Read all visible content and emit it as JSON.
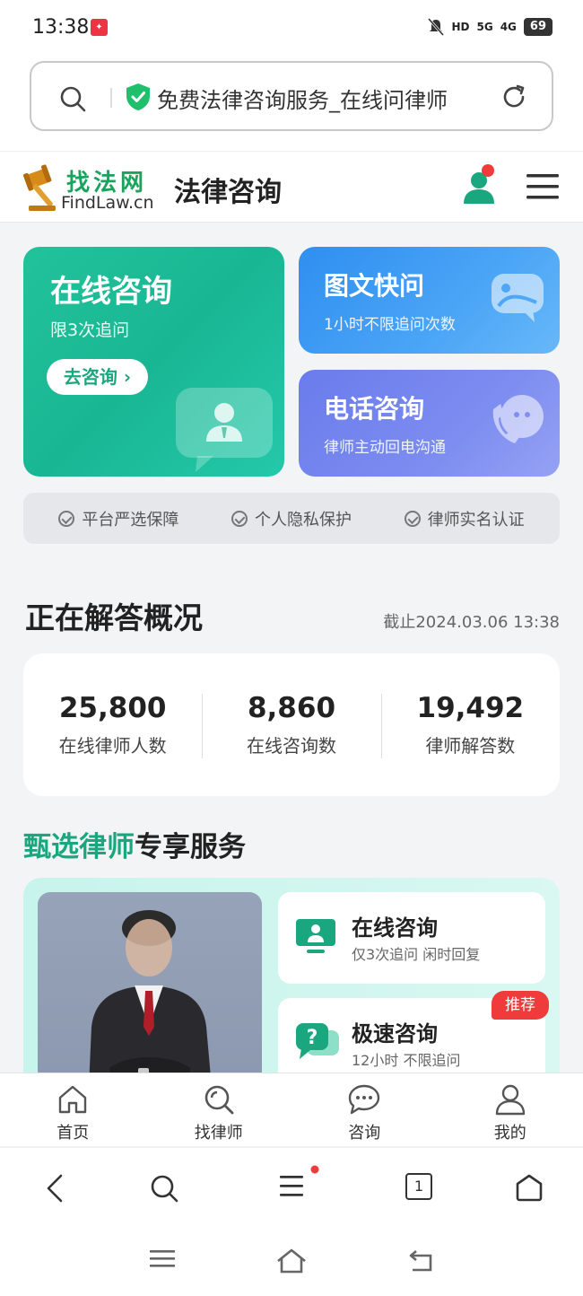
{
  "status": {
    "time": "13:38",
    "battery": "69",
    "network": [
      "HD",
      "5G",
      "4G"
    ]
  },
  "browser": {
    "url_title": "免费法律咨询服务_在线问律师"
  },
  "header": {
    "logo_cn": "找法网",
    "logo_en": "FindLaw.cn",
    "title": "法律咨询"
  },
  "hero": {
    "online": {
      "title": "在线咨询",
      "sub": "限3次追问",
      "button": "去咨询 ›"
    },
    "picture": {
      "title": "图文快问",
      "sub": "1小时不限追问次数"
    },
    "phone": {
      "title": "电话咨询",
      "sub": "律师主动回电沟通"
    }
  },
  "guarantees": [
    "平台严选保障",
    "个人隐私保护",
    "律师实名认证"
  ],
  "stats_section": {
    "title": "正在解答概况",
    "date": "截止2024.03.06 13:38",
    "items": [
      {
        "value": "25,800",
        "label": "在线律师人数"
      },
      {
        "value": "8,860",
        "label": "在线咨询数"
      },
      {
        "value": "19,492",
        "label": "律师解答数"
      }
    ]
  },
  "lawyer_section": {
    "title_highlight": "甄选律师",
    "title_rest": "专享服务",
    "services": [
      {
        "title": "在线咨询",
        "sub": "仅3次追问 闲时回复"
      },
      {
        "title": "极速咨询",
        "sub": "12小时 不限追问",
        "badge": "推荐"
      }
    ]
  },
  "tabs": [
    {
      "label": "首页",
      "icon": "home-icon"
    },
    {
      "label": "找律师",
      "icon": "search-icon"
    },
    {
      "label": "咨询",
      "icon": "chat-icon"
    },
    {
      "label": "我的",
      "icon": "profile-icon"
    }
  ],
  "browser_nav": {
    "tab_count": "1"
  },
  "colors": {
    "brand_green": "#1aa77f",
    "blue": "#2f8ff0",
    "purple": "#6a7cec",
    "badge_red": "#ef3b3b"
  }
}
